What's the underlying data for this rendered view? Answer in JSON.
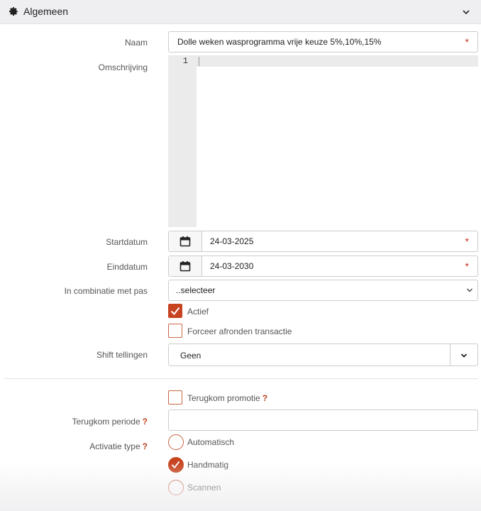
{
  "panel": {
    "title": "Algemeen",
    "header_icon": "gear-icon",
    "collapse_icon": "chevron-down-icon"
  },
  "form": {
    "naam": {
      "label": "Naam",
      "value": "Dolle weken wasprogramma vrije keuze 5%,10%,15%",
      "required_mark": "*"
    },
    "omschrijving": {
      "label": "Omschrijving",
      "line_number": "1"
    },
    "startdatum": {
      "label": "Startdatum",
      "value": "24-03-2025",
      "required_mark": "*"
    },
    "einddatum": {
      "label": "Einddatum",
      "value": "24-03-2030",
      "required_mark": "*"
    },
    "combinatie": {
      "label": "In combinatie met pas",
      "selected": "..selecteer"
    },
    "actief": {
      "label": "Actief",
      "checked": true
    },
    "forceer": {
      "label": "Forceer afronden transactie",
      "checked": false
    },
    "shift": {
      "label": "Shift tellingen",
      "value": "Geen"
    },
    "terugkom_promotie": {
      "label": "Terugkom promotie",
      "help": "?",
      "checked": false
    },
    "terugkom_periode": {
      "label": "Terugkom periode",
      "help": "?",
      "value": ""
    },
    "activatie": {
      "label": "Activatie type",
      "help": "?",
      "options": [
        {
          "label": "Automatisch",
          "checked": false
        },
        {
          "label": "Handmatig",
          "checked": true
        },
        {
          "label": "Scannen",
          "checked": false
        }
      ]
    }
  },
  "colors": {
    "accent": "#c8431f",
    "header_bg": "#efeff1",
    "border": "#cccccc"
  }
}
